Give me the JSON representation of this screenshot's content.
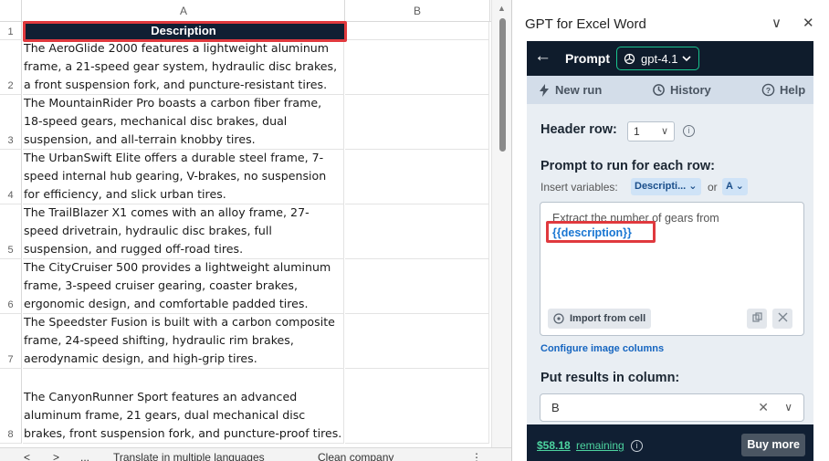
{
  "sheet": {
    "columns": [
      "A",
      "B"
    ],
    "header": {
      "row_number": "1",
      "text": "Description"
    },
    "rows": [
      {
        "num": "2",
        "text": "The AeroGlide 2000 features a lightweight aluminum frame, a 21-speed gear system, hydraulic disc brakes, a front suspension fork, and puncture-resistant tires."
      },
      {
        "num": "3",
        "text": "The MountainRider Pro boasts a carbon fiber frame, 18-speed gears, mechanical disc brakes, dual suspension, and all-terrain knobby tires."
      },
      {
        "num": "4",
        "text": "The UrbanSwift Elite offers a durable steel frame, 7-speed internal hub gearing, V-brakes, no suspension for efficiency, and slick urban tires."
      },
      {
        "num": "5",
        "text": "The TrailBlazer X1 comes with an alloy frame, 27-speed drivetrain, hydraulic disc brakes, full suspension, and rugged off-road tires."
      },
      {
        "num": "6",
        "text": "The CityCruiser 500 provides a lightweight aluminum frame, 3-speed cruiser gearing, coaster brakes, ergonomic design, and comfortable padded tires."
      },
      {
        "num": "7",
        "text": "The Speedster Fusion is built with a carbon composite frame, 24-speed shifting, hydraulic rim brakes, aerodynamic design, and high-grip tires."
      },
      {
        "num": "8",
        "text": "The CanyonRunner Sport features an advanced aluminum frame, 21 gears, dual mechanical disc brakes, front suspension fork, and puncture-proof tires."
      }
    ],
    "tabs": [
      "<",
      ">",
      "...",
      "Translate in multiple languages",
      "Clean company",
      "⋮"
    ]
  },
  "pane": {
    "title": "GPT for Excel Word",
    "collapse_glyph": "∨",
    "close_glyph": "✕",
    "topbar": {
      "back_glyph": "←",
      "prompt_label": "Prompt",
      "model": "gpt-4.1"
    },
    "nav": {
      "new_run": "New run",
      "history": "History",
      "help": "Help"
    },
    "header_row": {
      "label": "Header row:",
      "value": "1"
    },
    "prompt": {
      "label": "Prompt to run for each row:",
      "insert_label": "Insert variables:",
      "var_chip": "Descripti...",
      "or_label": "or",
      "col_chip": "A",
      "text_line1": "Extract the number of gears from",
      "text_var": "{{description}}",
      "import_label": "Import from cell"
    },
    "configure_link": "Configure image columns",
    "results": {
      "label": "Put results in column:",
      "value": "B"
    },
    "footer": {
      "amount": "$58.18",
      "remaining": "remaining",
      "buy": "Buy more"
    }
  },
  "colors": {
    "accent": "#19c38e",
    "highlight": "#e0393e",
    "header_bg": "#101f33",
    "link": "#1565c0"
  }
}
